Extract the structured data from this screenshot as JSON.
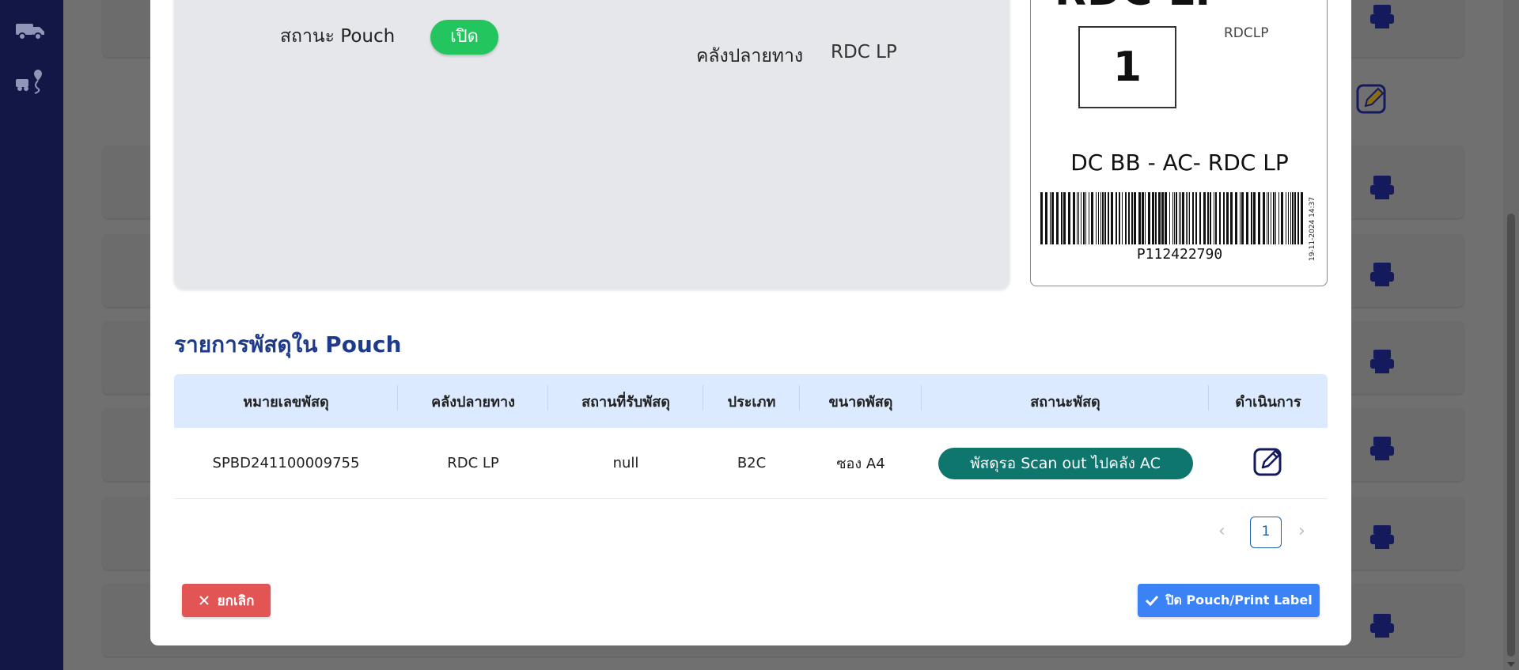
{
  "info": {
    "pouch_status_label": "สถานะ Pouch",
    "pouch_status_value": "เปิด",
    "destination_label": "คลังปลายทาง",
    "destination_value": "RDC LP"
  },
  "label": {
    "destination_big": "RDC LP",
    "number": "1",
    "logo_alt": "RDCLP",
    "route": "DC BB - AC- RDC LP",
    "barcode_number": "P112422790",
    "date": "19-11-2024 14:37"
  },
  "section_title": "รายการพัสดุใน Pouch",
  "table": {
    "headers": [
      "หมายเลขพัสดุ",
      "คลังปลายทาง",
      "สถานที่รับพัสดุ",
      "ประเภท",
      "ขนาดพัสดุ",
      "สถานะพัสดุ",
      "ดำเนินการ"
    ],
    "rows": [
      {
        "tracking": "SPBD241100009755",
        "destination": "RDC LP",
        "pickup": "null",
        "type": "B2C",
        "size": "ซอง A4",
        "status": "พัสดุรอ Scan out ไปคลัง AC"
      }
    ]
  },
  "pagination": {
    "current": "1",
    "prev": "‹",
    "next": "›"
  },
  "buttons": {
    "cancel": "ยกเลิก",
    "close_print": "ปิด Pouch/Print Label"
  },
  "colors": {
    "sidebar": "#131746",
    "accent_blue": "#1e3a8a",
    "open_badge": "#22c55e",
    "status_pill": "#0f766e",
    "cancel": "#e35555",
    "primary": "#3b82f6"
  }
}
